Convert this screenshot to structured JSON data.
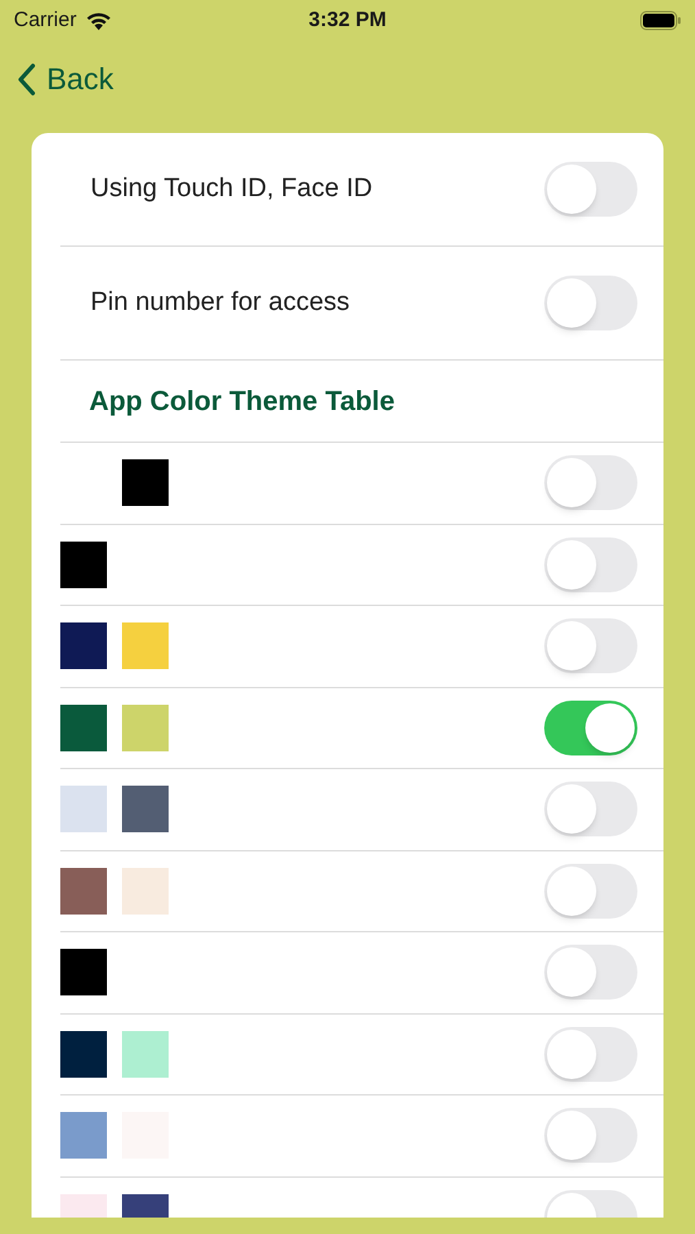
{
  "status_bar": {
    "carrier": "Carrier",
    "time": "3:32 PM"
  },
  "nav": {
    "back": "Back"
  },
  "settings": [
    {
      "label": "Using Touch ID, Face ID",
      "on": false
    },
    {
      "label": "Pin number for access",
      "on": false
    }
  ],
  "theme_table": {
    "title": "App Color Theme Table",
    "rows": [
      {
        "swatches": [
          {
            "kind": "empty"
          },
          {
            "kind": "filled",
            "color": "#000000"
          }
        ],
        "on": false
      },
      {
        "swatches": [
          {
            "color": "#000000"
          }
        ],
        "on": false
      },
      {
        "swatches": [
          {
            "color": "#0f1a55"
          },
          {
            "color": "#f5d03f"
          }
        ],
        "on": false
      },
      {
        "swatches": [
          {
            "color": "#0a5a3c"
          },
          {
            "color": "#cdd46a"
          }
        ],
        "on": true
      },
      {
        "swatches": [
          {
            "color": "#dbe2ef"
          },
          {
            "color": "#535e73"
          }
        ],
        "on": false
      },
      {
        "swatches": [
          {
            "color": "#885e58"
          },
          {
            "color": "#f8ebdf"
          }
        ],
        "on": false
      },
      {
        "swatches": [
          {
            "color": "#000000"
          }
        ],
        "on": false
      },
      {
        "swatches": [
          {
            "color": "#00203f"
          },
          {
            "color": "#adefd1"
          }
        ],
        "on": false
      },
      {
        "swatches": [
          {
            "color": "#7a9bcb"
          },
          {
            "color": "#fcf6f5"
          }
        ],
        "on": false
      },
      {
        "swatches": [
          {
            "color": "#fbe9ef"
          },
          {
            "color": "#36407a"
          }
        ],
        "on": false
      }
    ]
  }
}
